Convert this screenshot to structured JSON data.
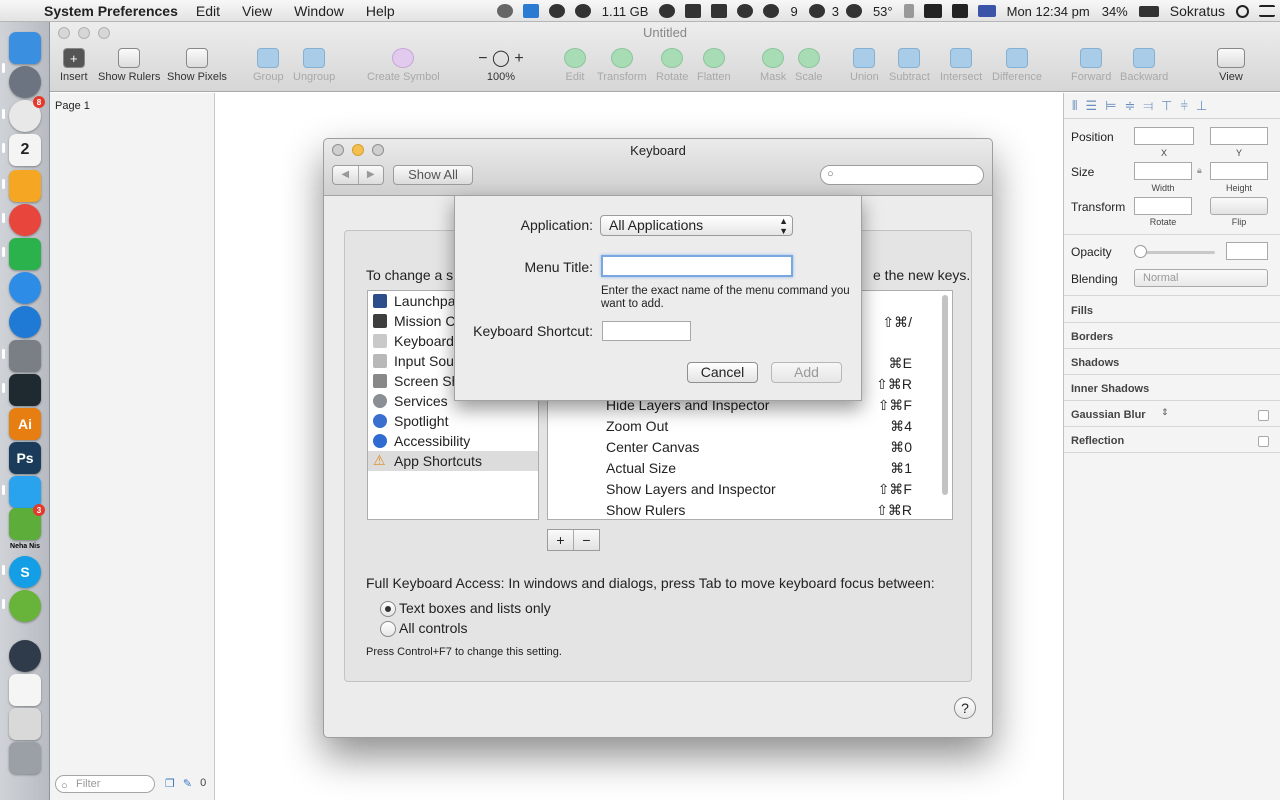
{
  "menubar": {
    "app_name": "System Preferences",
    "menus": [
      "Edit",
      "View",
      "Window",
      "Help"
    ],
    "memory": "1.11 GB",
    "badge_count_a": "9",
    "badge_count_b": "3",
    "temperature": "53°",
    "battery": "34%",
    "clock": "Mon 12:34 pm",
    "user": "Sokratus"
  },
  "dock": {
    "items": [
      {
        "name": "finder",
        "color": "#3b8fe0"
      },
      {
        "name": "launchpad",
        "color": "#6b7480"
      },
      {
        "name": "mail-badge",
        "color": "#e8e8e8",
        "badge": "8"
      },
      {
        "name": "calendar",
        "color": "#f4f4f4",
        "label": "2"
      },
      {
        "name": "sketch",
        "color": "#f5a623"
      },
      {
        "name": "chrome",
        "color": "#e8453c"
      },
      {
        "name": "feedly",
        "color": "#2bb24c"
      },
      {
        "name": "itunes",
        "color": "#2d8ce6"
      },
      {
        "name": "app-store",
        "color": "#1f7ad6"
      },
      {
        "name": "system-preferences",
        "color": "#7a7f86"
      },
      {
        "name": "activity-monitor",
        "color": "#1e2a30"
      },
      {
        "name": "illustrator",
        "color": "#e67e12",
        "label": "Ai"
      },
      {
        "name": "photoshop",
        "color": "#1a3c5a",
        "label": "Ps"
      },
      {
        "name": "twitter",
        "color": "#2aa3ef"
      },
      {
        "name": "adium",
        "color": "#5cad3a",
        "badge": "3",
        "caption": "Neha Nis"
      },
      {
        "name": "skype",
        "color": "#139ee6",
        "label": "S"
      },
      {
        "name": "utorrent",
        "color": "#68b43b"
      },
      {
        "name": "1password",
        "color": "#2f3a4a"
      },
      {
        "name": "document",
        "color": "#f5f5f5"
      },
      {
        "name": "preview",
        "color": "#d9d9d9"
      },
      {
        "name": "trash",
        "color": "#9aa0a6"
      }
    ]
  },
  "sketch": {
    "window_title": "Untitled",
    "toolbar": {
      "insert": "Insert",
      "show_rulers": "Show Rulers",
      "show_pixels": "Show Pixels",
      "group": "Group",
      "ungroup": "Ungroup",
      "create_symbol": "Create Symbol",
      "zoom": "100%",
      "edit": "Edit",
      "transform": "Transform",
      "rotate": "Rotate",
      "flatten": "Flatten",
      "mask": "Mask",
      "scale": "Scale",
      "union": "Union",
      "subtract": "Subtract",
      "intersect": "Intersect",
      "difference": "Difference",
      "forward": "Forward",
      "backward": "Backward",
      "view": "View"
    },
    "pages": {
      "current": "Page 1"
    },
    "filter_placeholder": "Filter",
    "filter_count": "0",
    "inspector": {
      "position": "Position",
      "x": "X",
      "y": "Y",
      "size": "Size",
      "width": "Width",
      "height": "Height",
      "transform": "Transform",
      "rotate": "Rotate",
      "flip": "Flip",
      "opacity": "Opacity",
      "blending": "Blending",
      "blending_value": "Normal",
      "fills": "Fills",
      "borders": "Borders",
      "shadows": "Shadows",
      "inner_shadows": "Inner Shadows",
      "gaussian_blur": "Gaussian Blur",
      "reflection": "Reflection"
    }
  },
  "keyboard": {
    "title": "Keyboard",
    "show_all": "Show All",
    "instructions_start": "To change a sh",
    "instructions_end": "e the new keys.",
    "categories": [
      "Launchpad & Dock",
      "Mission Control",
      "Keyboard",
      "Input Sources",
      "Screen Shots",
      "Services",
      "Spotlight",
      "Accessibility",
      "App Shortcuts"
    ],
    "shortcuts": [
      {
        "name": "Hide Layers and Inspector",
        "key": "⇧⌘F"
      },
      {
        "name": "Zoom Out",
        "key": "⌘4"
      },
      {
        "name": "Center Canvas",
        "key": "⌘0"
      },
      {
        "name": "Actual Size",
        "key": "⌘1"
      },
      {
        "name": "Show Layers and Inspector",
        "key": "⇧⌘F"
      },
      {
        "name": "Show Rulers",
        "key": "⇧⌘R"
      }
    ],
    "hidden_keys": [
      "⇧⌘/",
      "⌘E",
      "⇧⌘R"
    ],
    "plus": "+",
    "minus": "−",
    "full_keyboard_access": "Full Keyboard Access: In windows and dialogs, press Tab to move keyboard focus between:",
    "radio_text_boxes": "Text boxes and lists only",
    "radio_all_controls": "All controls",
    "hint": "Press Control+F7 to change this setting.",
    "help": "?"
  },
  "sheet": {
    "application_label": "Application:",
    "application_value": "All Applications",
    "menu_title_label": "Menu Title:",
    "menu_title_value": "",
    "help_text": "Enter the exact name of the menu command you want to add.",
    "shortcut_label": "Keyboard Shortcut:",
    "cancel": "Cancel",
    "add": "Add"
  }
}
